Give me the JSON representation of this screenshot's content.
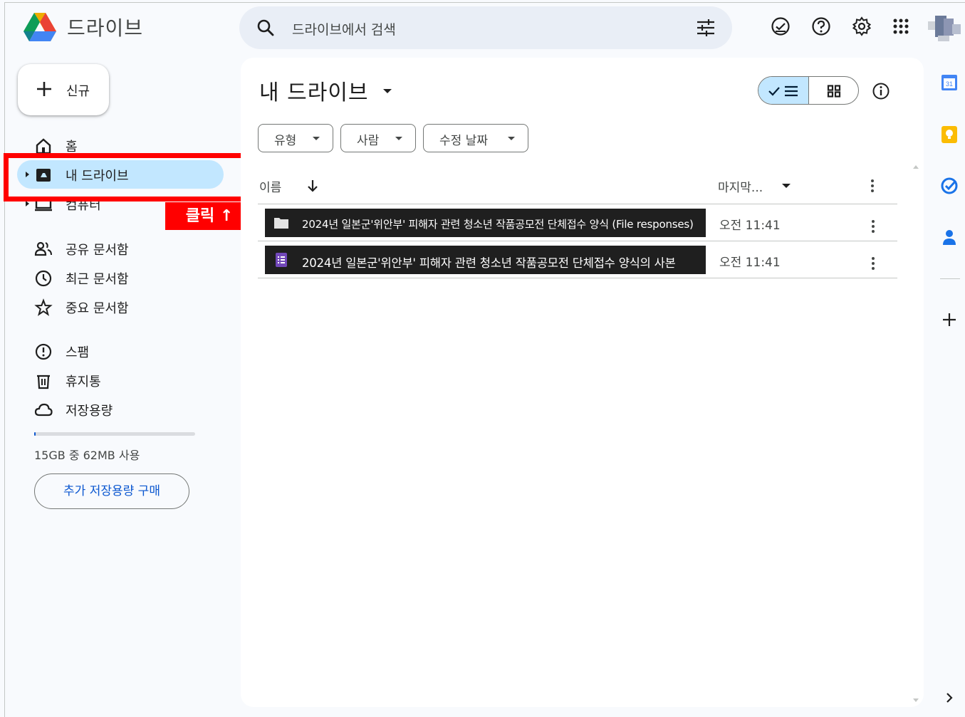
{
  "header": {
    "app_title": "드라이브",
    "search_placeholder": "드라이브에서 검색"
  },
  "sidebar": {
    "new_label": "신규",
    "items": [
      {
        "label": "홈"
      },
      {
        "label": "내 드라이브",
        "active": true
      },
      {
        "label": "컴퓨터"
      },
      {
        "label": "공유 문서함"
      },
      {
        "label": "최근 문서함"
      },
      {
        "label": "중요 문서함"
      },
      {
        "label": "스팸"
      },
      {
        "label": "휴지통"
      },
      {
        "label": "저장용량"
      }
    ],
    "storage_text": "15GB 중 62MB 사용",
    "storage_used_fraction": 0.004,
    "buy_storage_label": "추가 저장용량 구매"
  },
  "annotation": {
    "click_label": "클릭 ↑",
    "color": "#ff0000"
  },
  "main": {
    "title": "내 드라이브",
    "filters": [
      "유형",
      "사람",
      "수정 날짜"
    ],
    "columns": {
      "name": "이름",
      "modified": "마지막..."
    },
    "files": [
      {
        "icon": "folder-icon",
        "name": "2024년 일본군'위안부' 피해자 관련 청소년 작품공모전 단체접수 양식 (File responses)",
        "modified": "오전 11:41"
      },
      {
        "icon": "form-icon",
        "name": "2024년 일본군'위안부' 피해자 관련 청소년 작품공모전 단체접수 양식의 사본",
        "modified": "오전 11:41"
      }
    ]
  },
  "colors": {
    "active_nav": "#c2e7ff",
    "accent": "#0b57d0",
    "form_icon": "#7248b9"
  }
}
